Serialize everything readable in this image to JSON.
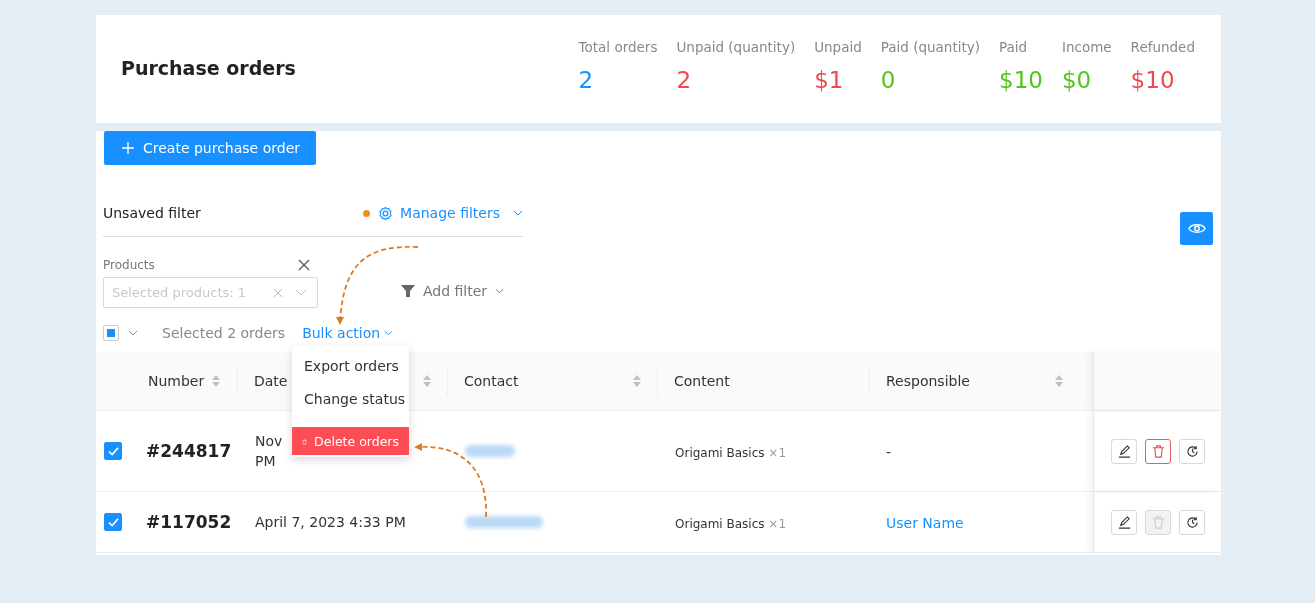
{
  "header": {
    "title": "Purchase orders",
    "stats": [
      {
        "label": "Total orders",
        "value": "2",
        "color": "#1890ff"
      },
      {
        "label": "Unpaid (quantity)",
        "value": "2",
        "color": "#f0484e"
      },
      {
        "label": "Unpaid",
        "value": "$1",
        "color": "#f0484e"
      },
      {
        "label": "Paid (quantity)",
        "value": "0",
        "color": "#52c41a"
      },
      {
        "label": "Paid",
        "value": "$10",
        "color": "#52c41a"
      },
      {
        "label": "Income",
        "value": "$0",
        "color": "#52c41a"
      },
      {
        "label": "Refunded",
        "value": "$10",
        "color": "#f0484e"
      }
    ]
  },
  "create_button": "Create purchase order",
  "filter": {
    "name": "Unsaved filter",
    "unsaved": true,
    "manage": "Manage filters",
    "field_label": "Products",
    "field_placeholder": "Selected products: 1",
    "add_filter": "Add filter"
  },
  "selection": {
    "partial": true,
    "text": "Selected 2 orders",
    "bulk": "Bulk action"
  },
  "menu": {
    "items": [
      {
        "label": "Export orders",
        "kind": "plain"
      },
      {
        "label": "Change status",
        "kind": "plain"
      },
      {
        "label": "Delete orders",
        "kind": "danger"
      }
    ]
  },
  "table": {
    "columns": [
      {
        "label": "Number",
        "sortable": true
      },
      {
        "label": "Date",
        "sortable": true
      },
      {
        "label": "Contact",
        "sortable": true
      },
      {
        "label": "Content",
        "sortable": false
      },
      {
        "label": "Responsible",
        "sortable": true
      }
    ],
    "rows": [
      {
        "checked": true,
        "number": "#244817",
        "date": [
          "Nov",
          "PM"
        ],
        "contact_redacted": true,
        "content": "Origami Basics",
        "qty": "×1",
        "responsible": "-",
        "responsible_link": false,
        "delete_disabled": false
      },
      {
        "checked": true,
        "number": "#117052",
        "date": [
          "April 7, 2023 4:33 PM"
        ],
        "contact_redacted": true,
        "content": "Origami Basics",
        "qty": "×1",
        "responsible": "User Name",
        "responsible_link": true,
        "delete_disabled": true
      }
    ]
  }
}
